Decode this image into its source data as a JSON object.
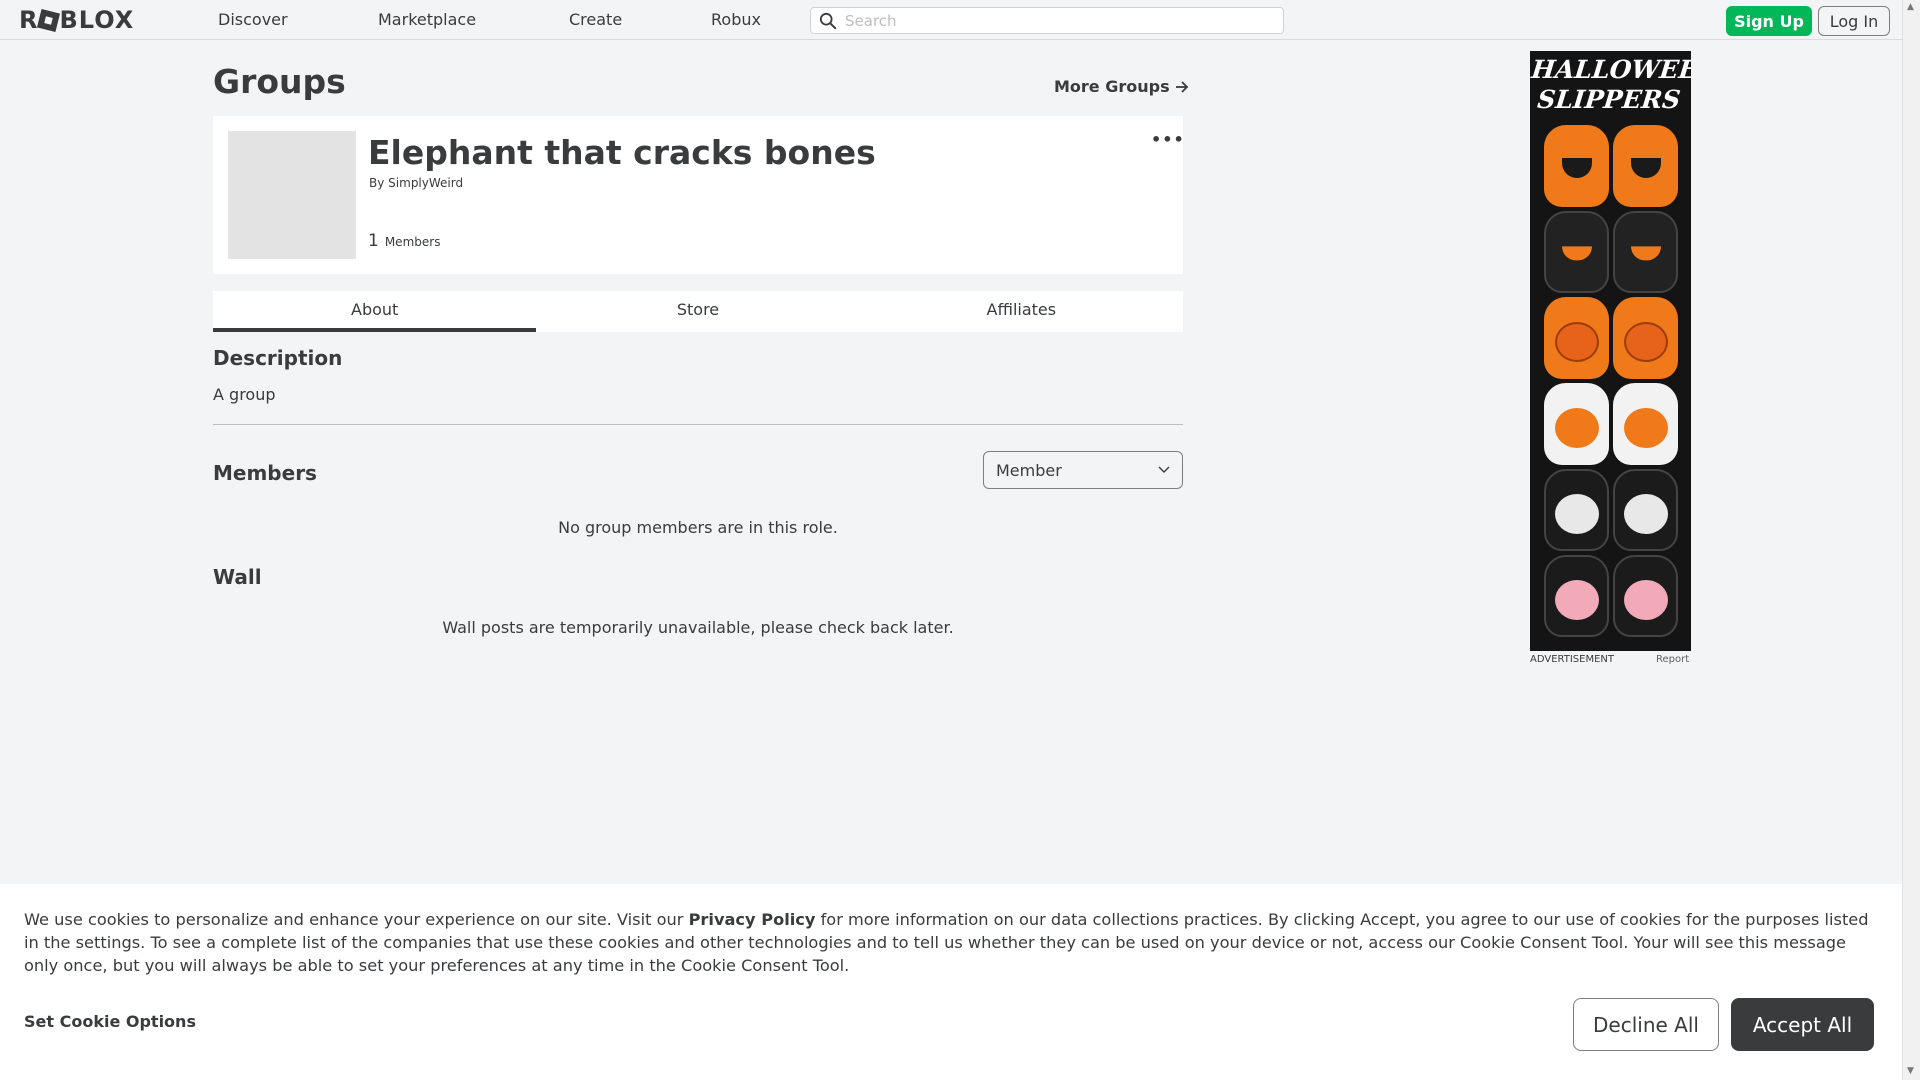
{
  "header": {
    "logo_text_left": "R",
    "logo_text_right": "BLOX",
    "nav": [
      "Discover",
      "Marketplace",
      "Create",
      "Robux"
    ],
    "search_placeholder": "Search",
    "signup_label": "Sign Up",
    "login_label": "Log In"
  },
  "page": {
    "title": "Groups",
    "more_groups_label": "More Groups"
  },
  "group": {
    "name": "Elephant that cracks bones",
    "owner_prefix": "By",
    "owner_name": "SimplyWeird",
    "member_count": "1",
    "members_label": "Members",
    "menu_icon": "more-dots-icon"
  },
  "tabs": [
    "About",
    "Store",
    "Affiliates"
  ],
  "about": {
    "description_heading": "Description",
    "description_text": "A group",
    "members_heading": "Members",
    "role_selected": "Member",
    "members_empty": "No group members are in this role.",
    "wall_heading": "Wall",
    "wall_message": "Wall posts are temporarily unavailable, please check back later."
  },
  "ad": {
    "title_line1": "HALLOWEEN",
    "title_line2": "SLIPPERS",
    "label": "ADVERTISEMENT",
    "report_label": "Report"
  },
  "cookie": {
    "text_before_link": "We use cookies to personalize and enhance your experience on our site. Visit our ",
    "link_text": "Privacy Policy",
    "text_after_link": " for more information on our data collections practices. By clicking Accept, you agree to our use of cookies for the purposes listed in the settings. To see a complete list of the companies that use these cookies and other technologies and to tell us whether they can be used on your device or not, access our Cookie Consent Tool. Your will see this message only once, but you will always be able to set your preferences at any time in the Cookie Consent Tool.",
    "options_label": "Set Cookie Options",
    "decline_label": "Decline All",
    "accept_label": "Accept All"
  },
  "colors": {
    "signup_green": "#02b757",
    "text_dark": "#393b3d",
    "page_bg": "#f2f4f5"
  }
}
